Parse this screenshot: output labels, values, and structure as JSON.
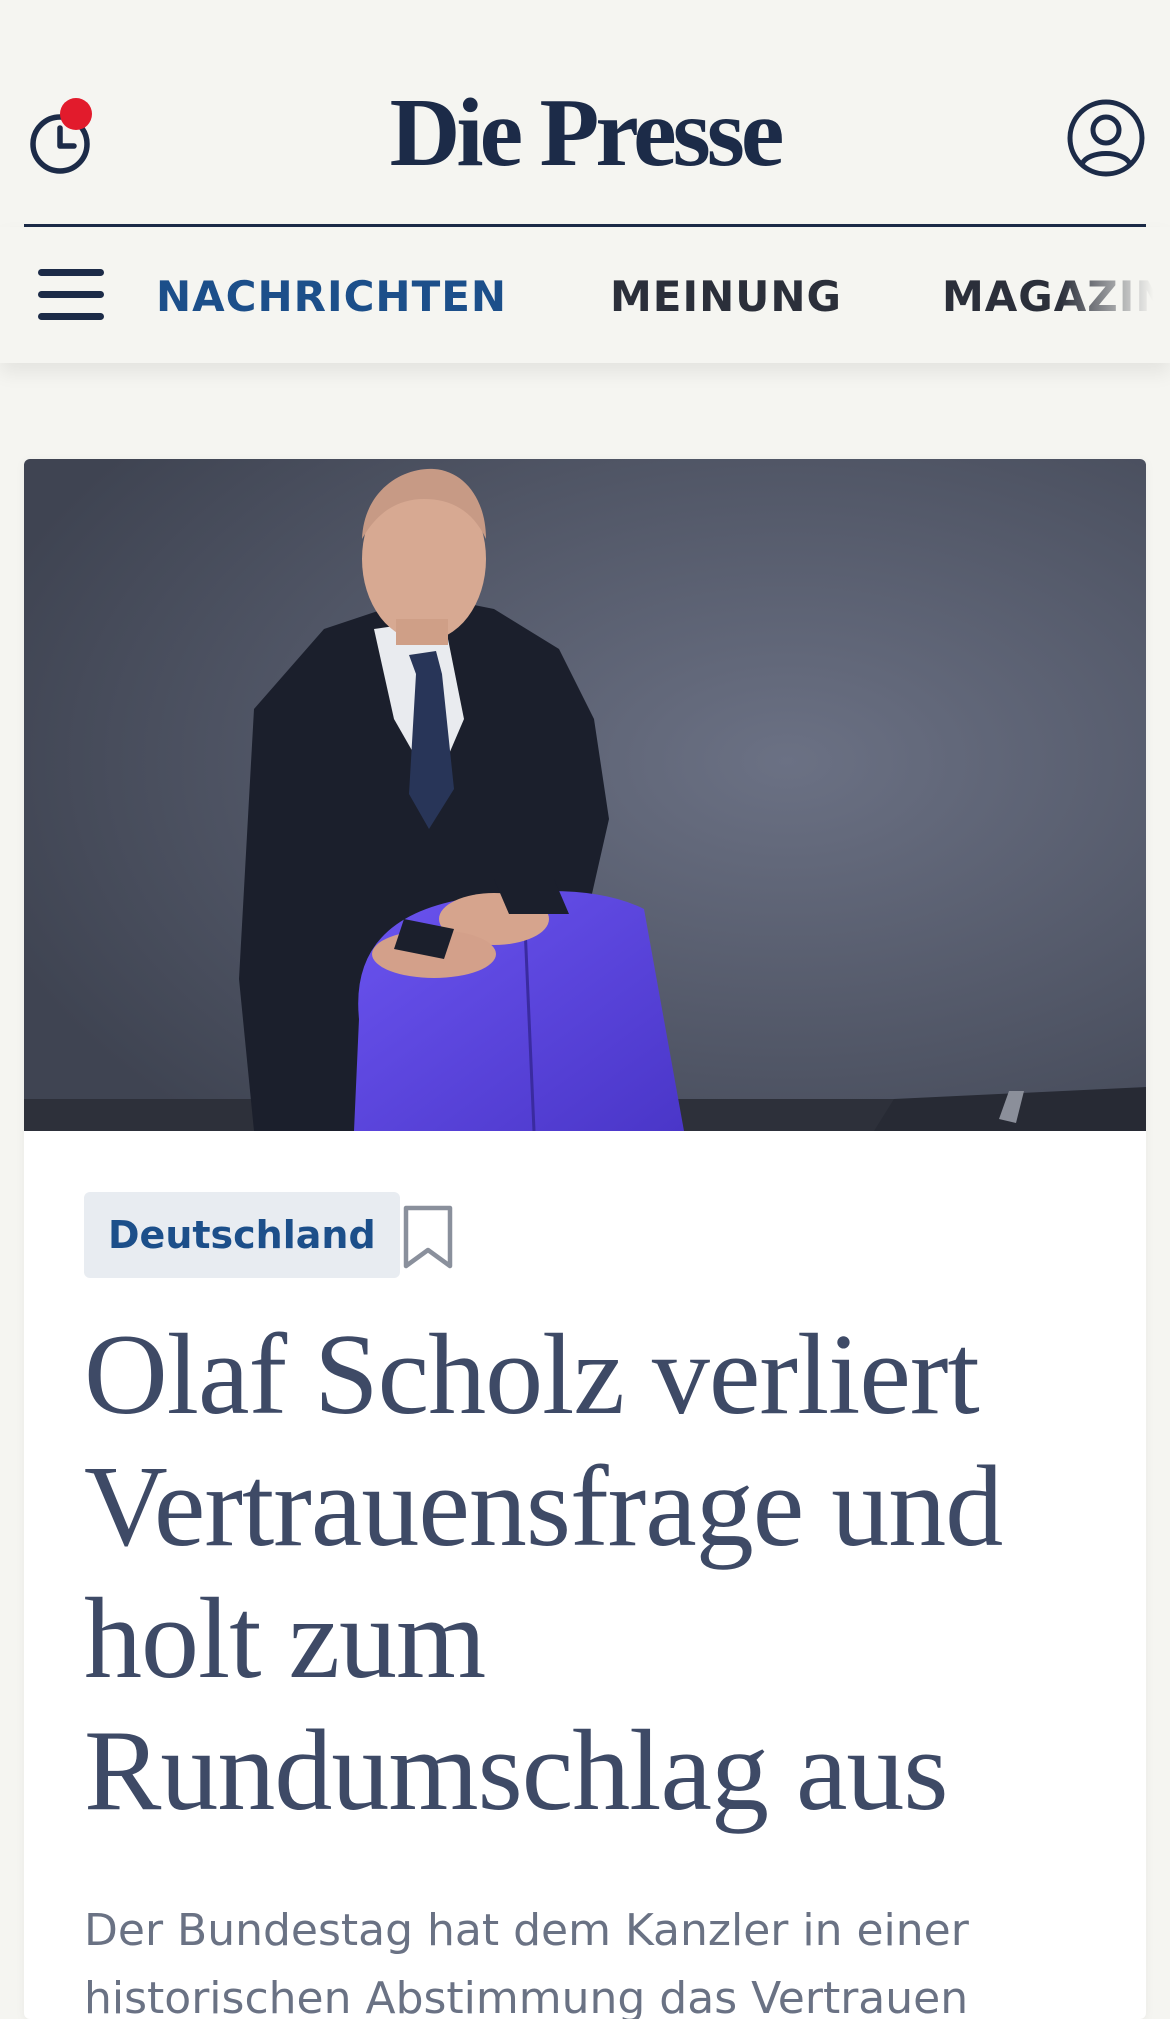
{
  "header": {
    "logo_text": "Die Presse",
    "brand_color": "#1c2b48",
    "notification_color": "#e21b2c",
    "left_icon": "clock-icon",
    "right_icon": "user-account-icon"
  },
  "nav": {
    "menu_icon": "hamburger-menu-icon",
    "items": [
      {
        "label": "NACHRICHTEN",
        "active": true
      },
      {
        "label": "MEINUNG",
        "active": false
      },
      {
        "label": "MAGAZIN",
        "active": false
      }
    ],
    "active_color": "#1c4f8a"
  },
  "article": {
    "category": "Deutschland",
    "bookmark_icon": "bookmark-icon",
    "headline": "Olaf Scholz verliert Vertrauensfrage und holt zum Rundumschlag aus",
    "lead": "Der Bundestag hat dem Kanzler in einer historischen Abstimmung das Vertrauen entzogen."
  }
}
